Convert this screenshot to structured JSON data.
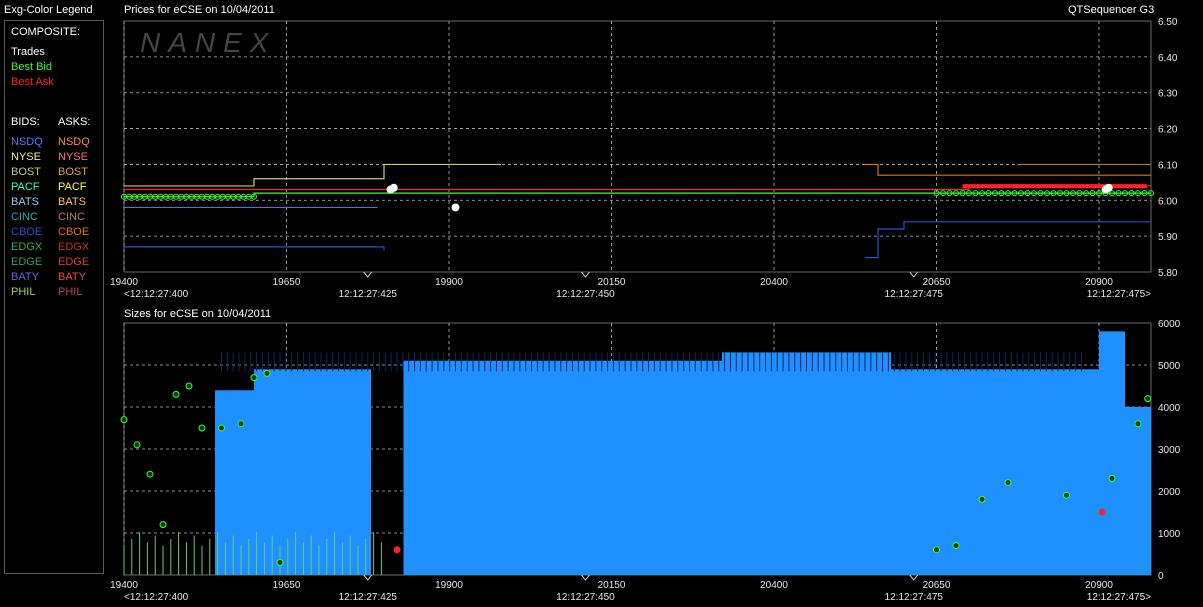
{
  "legend": {
    "title": "Exg-Color Legend",
    "composite_label": "COMPOSITE:",
    "composite": [
      {
        "label": "Trades",
        "color": "#ffffff"
      },
      {
        "label": "Best Bid",
        "color": "#33ff33"
      },
      {
        "label": "Best Ask",
        "color": "#ff2222"
      }
    ],
    "bids_header": "BIDS:",
    "asks_header": "ASKS:",
    "exchanges": [
      {
        "bid": "NSDQ",
        "ask": "NSDQ",
        "bid_color": "#4f7bff",
        "ask_color": "#ff8c3a"
      },
      {
        "bid": "NYSE",
        "ask": "NYSE",
        "bid_color": "#f0f0a0",
        "ask_color": "#ff7070"
      },
      {
        "bid": "BOST",
        "ask": "BOST",
        "bid_color": "#c9c96e",
        "ask_color": "#d7a04a"
      },
      {
        "bid": "PACF",
        "ask": "PACF",
        "bid_color": "#40ffc0",
        "ask_color": "#ffff60"
      },
      {
        "bid": "BATS",
        "ask": "BATS",
        "bid_color": "#a0c8ff",
        "ask_color": "#ffc060"
      },
      {
        "bid": "CINC",
        "ask": "CINC",
        "bid_color": "#3aa7a7",
        "ask_color": "#b08060"
      },
      {
        "bid": "CBOE",
        "ask": "CBOE",
        "bid_color": "#2a4fd0",
        "ask_color": "#e07020"
      },
      {
        "bid": "EDGX",
        "ask": "EDGX",
        "bid_color": "#36b04a",
        "ask_color": "#c03030"
      },
      {
        "bid": "EDGE",
        "ask": "EDGE",
        "bid_color": "#2f9f6f",
        "ask_color": "#d04040"
      },
      {
        "bid": "BATY",
        "ask": "BATY",
        "bid_color": "#5a6fd8",
        "ask_color": "#e05050"
      },
      {
        "bid": "PHIL",
        "ask": "PHIL",
        "bid_color": "#9ad36a",
        "ask_color": "#c04060"
      }
    ]
  },
  "header": {
    "price_title": "Prices for  eCSE  on  10/04/2011",
    "app_name": "QTSequencer G3",
    "size_title": "Sizes for  eCSE  on  10/04/2011",
    "watermark": "NANEX"
  },
  "chart_data": [
    {
      "type": "line",
      "title": "Prices for  eCSE  on  10/04/2011",
      "x_ticks": [
        "19400",
        "19650",
        "19900",
        "20150",
        "20400",
        "20650",
        "20900"
      ],
      "time_ticks": [
        "<12:12:27:400",
        "12:12:27:425",
        "12:12:27:450",
        "12:12:27:475",
        "12:12:27:475>"
      ],
      "xlim": [
        19400,
        20980
      ],
      "ylim": [
        5.8,
        6.5
      ],
      "y_ticks": [
        "6.50",
        "6.40",
        "6.30",
        "6.20",
        "6.10",
        "6.00",
        "5.90",
        "5.80"
      ],
      "grid": true,
      "series": [
        {
          "color": "#33ff33",
          "values": [
            [
              19400,
              6.01
            ],
            [
              19600,
              6.02
            ],
            [
              19800,
              6.02
            ],
            [
              20500,
              6.02
            ],
            [
              20900,
              6.02
            ],
            [
              20980,
              6.02
            ]
          ]
        },
        {
          "color": "#ff2222",
          "values": [
            [
              19400,
              6.03
            ],
            [
              19780,
              6.03
            ],
            [
              19820,
              6.03
            ],
            [
              20700,
              6.04
            ],
            [
              20980,
              6.04
            ]
          ]
        },
        {
          "color": "#c9c96e",
          "values": [
            [
              19400,
              6.04
            ],
            [
              19600,
              6.06
            ],
            [
              19800,
              6.1
            ],
            [
              19980,
              6.1
            ]
          ]
        },
        {
          "color": "#e07020",
          "values": [
            [
              20540,
              6.1
            ],
            [
              20560,
              6.07
            ],
            [
              20980,
              6.07
            ]
          ]
        },
        {
          "color": "#a08020",
          "values": [
            [
              20780,
              6.1
            ],
            [
              20980,
              6.1
            ]
          ]
        },
        {
          "color": "#2a4fd0",
          "values": [
            [
              19400,
              5.87
            ],
            [
              19800,
              5.86
            ]
          ]
        },
        {
          "color": "#2a4fd0",
          "values": [
            [
              20540,
              5.84
            ],
            [
              20560,
              5.92
            ],
            [
              20600,
              5.94
            ],
            [
              20980,
              5.94
            ]
          ]
        },
        {
          "color": "#5a6fd8",
          "values": [
            [
              19400,
              5.98
            ],
            [
              19790,
              5.98
            ]
          ]
        }
      ],
      "trades": [
        [
          19810,
          6.03
        ],
        [
          19815,
          6.035
        ],
        [
          19910,
          5.98
        ],
        [
          20910,
          6.03
        ],
        [
          20915,
          6.035
        ]
      ]
    },
    {
      "type": "area",
      "title": "Sizes for  eCSE  on  10/04/2011",
      "x_ticks": [
        "19400",
        "19650",
        "19900",
        "20150",
        "20400",
        "20650",
        "20900"
      ],
      "time_ticks": [
        "<12:12:27:400",
        "12:12:27:425",
        "12:12:27:450",
        "12:12:27:475",
        "12:12:27:475>"
      ],
      "xlim": [
        19400,
        20980
      ],
      "ylim": [
        0,
        6000
      ],
      "y_ticks": [
        "6000",
        "5000",
        "4000",
        "3000",
        "2000",
        "1000",
        "0"
      ],
      "grid": true,
      "series": [
        {
          "color": "#1e90ff",
          "values": [
            [
              19400,
              0
            ],
            [
              19500,
              0
            ],
            [
              19540,
              4400
            ],
            [
              19590,
              4400
            ],
            [
              19600,
              4900
            ],
            [
              19760,
              4900
            ],
            [
              19780,
              0
            ],
            [
              19800,
              0
            ],
            [
              19830,
              5100
            ],
            [
              20300,
              5100
            ],
            [
              20320,
              5300
            ],
            [
              20560,
              5300
            ],
            [
              20580,
              4900
            ],
            [
              20880,
              4900
            ],
            [
              20900,
              5800
            ],
            [
              20940,
              4000
            ],
            [
              20980,
              4200
            ]
          ]
        }
      ],
      "best_bid_markers": [
        [
          19400,
          3700
        ],
        [
          19420,
          3100
        ],
        [
          19440,
          2400
        ],
        [
          19460,
          1200
        ],
        [
          19480,
          4300
        ],
        [
          19500,
          4500
        ],
        [
          19520,
          3500
        ],
        [
          19550,
          3500
        ],
        [
          19580,
          3600
        ],
        [
          19600,
          4700
        ],
        [
          19620,
          4800
        ],
        [
          19640,
          300
        ],
        [
          20650,
          600
        ],
        [
          20680,
          700
        ],
        [
          20720,
          1800
        ],
        [
          20760,
          2200
        ],
        [
          20850,
          1900
        ],
        [
          20920,
          2300
        ],
        [
          20960,
          3600
        ],
        [
          20975,
          4200
        ]
      ],
      "best_ask_markers": [
        [
          19820,
          600
        ],
        [
          20905,
          1500
        ]
      ]
    }
  ]
}
